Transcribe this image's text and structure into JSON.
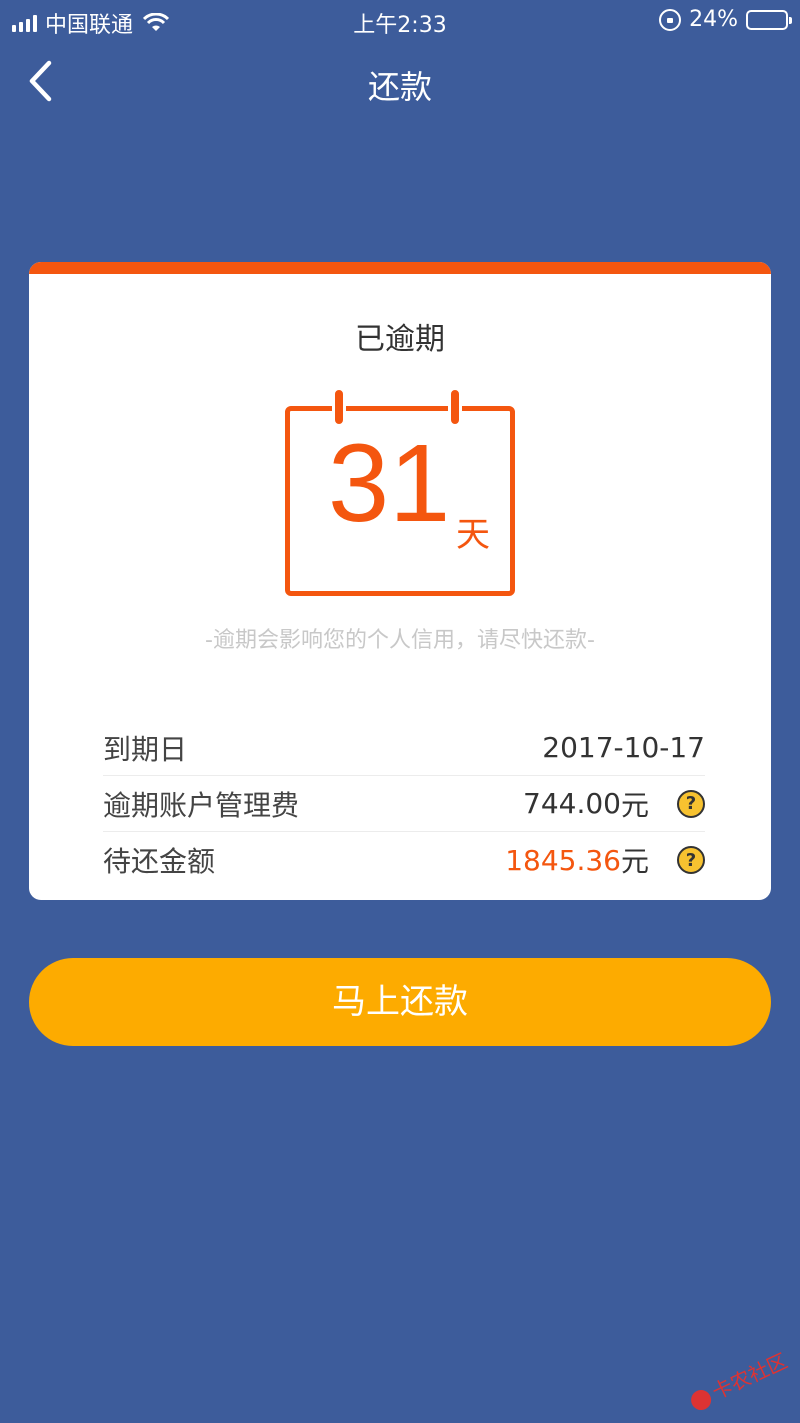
{
  "status_bar": {
    "carrier": "中国联通",
    "time": "上午2:33",
    "battery": "24%",
    "battery_level": 0.24
  },
  "nav": {
    "title": "还款",
    "back_icon": "chevron-left-icon"
  },
  "card": {
    "status_label": "已逾期",
    "days_overdue": "31",
    "days_unit": "天",
    "warning": "-逾期会影响您的个人信用，请尽快还款-",
    "rows": [
      {
        "label": "到期日",
        "value": "2017-10-17",
        "unit": ""
      },
      {
        "label": "逾期账户管理费",
        "value": "744.00",
        "unit": "元"
      },
      {
        "label": "待还金额",
        "value": "1845.36",
        "unit": "元"
      }
    ],
    "help_symbol": "?"
  },
  "pay_button": {
    "label": "马上还款"
  },
  "watermark": {
    "text": "卡农社区"
  },
  "colors": {
    "background": "#3d5c9b",
    "accent": "#f4560f",
    "button": "#fdab00",
    "help_icon": "#f7c230"
  }
}
